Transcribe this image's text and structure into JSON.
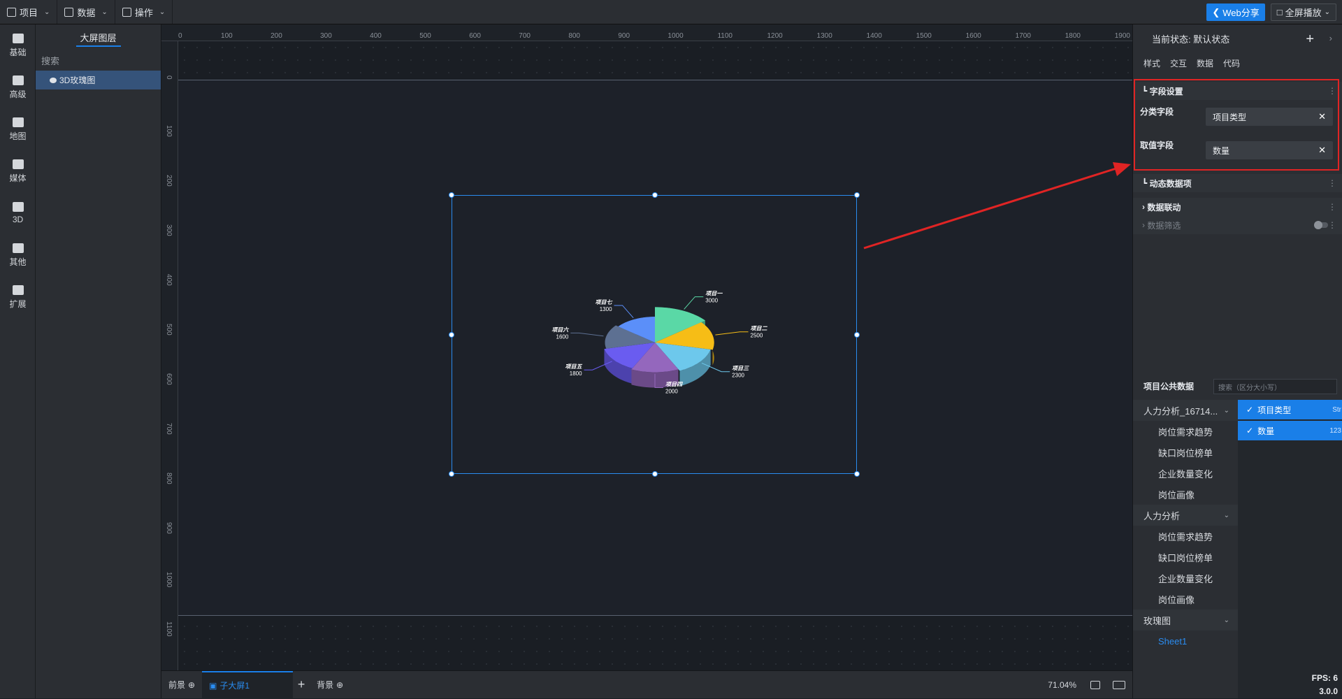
{
  "topbar": {
    "menus": [
      "项目",
      "数据",
      "操作"
    ],
    "web_share": "Web分享",
    "fullscreen": "全屏播放"
  },
  "rail": [
    "基础",
    "高级",
    "地图",
    "媒体",
    "3D",
    "其他",
    "扩展"
  ],
  "layers": {
    "title": "大屏图层",
    "search_placeholder": "搜索",
    "items": [
      "3D玫瑰图"
    ]
  },
  "ruler": {
    "top": [
      "0",
      "100",
      "200",
      "300",
      "400",
      "500",
      "600",
      "700",
      "800",
      "900",
      "1000",
      "1100",
      "1200",
      "1300",
      "1400",
      "1500",
      "1600",
      "1700",
      "1800",
      "1900"
    ],
    "left": [
      "0",
      "100",
      "200",
      "300",
      "400",
      "500",
      "600",
      "700",
      "800",
      "900",
      "1000",
      "1100"
    ]
  },
  "chart_data": {
    "type": "pie",
    "variant": "3d-rose",
    "slices": [
      {
        "name": "项目一",
        "value": 3000,
        "color": "#5ad8a6"
      },
      {
        "name": "项目二",
        "value": 2500,
        "color": "#f6bd16"
      },
      {
        "name": "项目三",
        "value": 2300,
        "color": "#6dc8ec"
      },
      {
        "name": "项目四",
        "value": 2000,
        "color": "#9467bd"
      },
      {
        "name": "项目五",
        "value": 1800,
        "color": "#6a5cf0"
      },
      {
        "name": "项目六",
        "value": 1600,
        "color": "#5d7092"
      },
      {
        "name": "项目七",
        "value": 1300,
        "color": "#5b8ff9"
      }
    ]
  },
  "bottombar": {
    "tabs": [
      "前景",
      "子大屏1",
      "背景"
    ],
    "zoom": "71.04%"
  },
  "rpanel": {
    "state_label": "当前状态:",
    "state_value": "默认状态",
    "tabs": [
      "样式",
      "交互",
      "数据",
      "代码"
    ],
    "field_section": "字段设置",
    "category_label": "分类字段",
    "category_value": "项目类型",
    "value_label": "取值字段",
    "value_value": "数量",
    "dynamic_section": "动态数据项",
    "link_section": "数据联动",
    "filter_section": "数据筛选",
    "public_data": "项目公共数据",
    "public_search_placeholder": "搜索（区分大小写）",
    "tree": [
      {
        "group": "人力分析_16714...",
        "items": [
          "岗位需求趋势",
          "缺口岗位榜单",
          "企业数量变化",
          "岗位画像"
        ]
      },
      {
        "group": "人力分析",
        "items": [
          "岗位需求趋势",
          "缺口岗位榜单",
          "企业数量变化",
          "岗位画像"
        ]
      },
      {
        "group": "玫瑰图",
        "items": [
          "Sheet1"
        ]
      }
    ],
    "fields": [
      {
        "name": "项目类型",
        "type": "Str"
      },
      {
        "name": "数量",
        "type": "123"
      }
    ],
    "fps": "FPS: 6",
    "version": "3.0.0"
  }
}
